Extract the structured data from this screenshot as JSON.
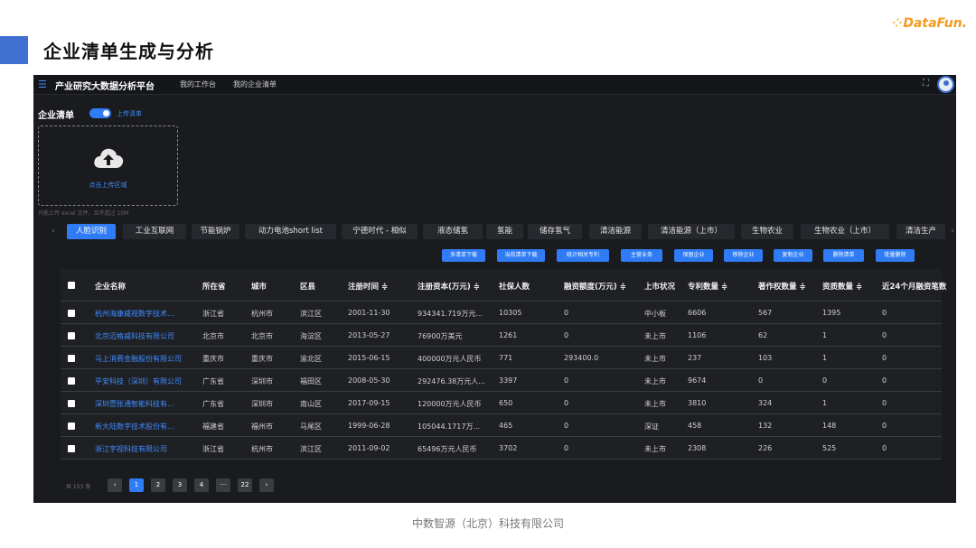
{
  "slide": {
    "title": "企业清单生成与分析",
    "logo": "DataFun.",
    "footer": "中数智源（北京）科技有限公司"
  },
  "app": {
    "title": "产业研究大数据分析平台",
    "nav": [
      "我的工作台",
      "我的企业清单"
    ],
    "list_label": "企业清单",
    "toggle_label": "上传清单",
    "upload_zone_label": "点击上传区域",
    "upload_hint": "只能上传 excel 文件，且不超过 10M"
  },
  "tabs": [
    "人脸识别",
    "工业互联网",
    "节能锅炉",
    "动力电池short list",
    "宁德时代 - 相似",
    "液态储氢",
    "氢能",
    "储存氢气",
    "清洁能源",
    "清洁能源（上市）",
    "生物农业",
    "生物农业（上市）",
    "清洁生产"
  ],
  "actions": [
    "多清单下载",
    "当前清单下载",
    "统计相关专利",
    "主营业务",
    "保留企业",
    "移除企业",
    "复制企业",
    "删除清单",
    "批量删除"
  ],
  "table": {
    "headers": [
      "企业名称",
      "所在省",
      "城市",
      "区县",
      "注册时间 ≑",
      "注册资本(万元) ≑",
      "社保人数",
      "融资额度(万元) ≑",
      "上市状况",
      "专利数量 ≑",
      "著作权数量 ≑",
      "资质数量 ≑",
      "近24个月融资笔数"
    ],
    "rows": [
      [
        "杭州海康威视数字技术...",
        "浙江省",
        "杭州市",
        "滨江区",
        "2001-11-30",
        "934341.719万元...",
        "10305",
        "0",
        "中小板",
        "6606",
        "567",
        "1395",
        "0"
      ],
      [
        "北京迈格威科技有限公司",
        "北京市",
        "北京市",
        "海淀区",
        "2013-05-27",
        "76900万美元",
        "1261",
        "0",
        "未上市",
        "1106",
        "62",
        "1",
        "0"
      ],
      [
        "马上消费金融股份有限公司",
        "重庆市",
        "重庆市",
        "渝北区",
        "2015-06-15",
        "400000万元人民币",
        "771",
        "293400.0",
        "未上市",
        "237",
        "103",
        "1",
        "0"
      ],
      [
        "平安科技（深圳）有限公司",
        "广东省",
        "深圳市",
        "福田区",
        "2008-05-30",
        "292476.38万元人...",
        "3397",
        "0",
        "未上市",
        "9674",
        "0",
        "0",
        "0"
      ],
      [
        "深圳壹账通智能科技有...",
        "广东省",
        "深圳市",
        "南山区",
        "2017-09-15",
        "120000万元人民币",
        "650",
        "0",
        "未上市",
        "3810",
        "324",
        "1",
        "0"
      ],
      [
        "新大陆数字技术股份有...",
        "福建省",
        "福州市",
        "马尾区",
        "1999-06-28",
        "105044.1717万...",
        "465",
        "0",
        "深证",
        "458",
        "132",
        "148",
        "0"
      ],
      [
        "浙江宇视科技有限公司",
        "浙江省",
        "杭州市",
        "滨江区",
        "2011-09-02",
        "65496万元人民币",
        "3702",
        "0",
        "未上市",
        "2308",
        "226",
        "525",
        "0"
      ]
    ]
  },
  "pager": {
    "total": "共 153 条",
    "prev": "‹",
    "pages": [
      "1",
      "2",
      "3",
      "4",
      "···",
      "22"
    ],
    "next": "›"
  },
  "colors": {
    "accent": "#2f7cf6",
    "slide_accent": "#3f6fd0",
    "link": "#3f8cff",
    "app_bg": "#1a1b1f",
    "logo": "#f29b22"
  }
}
